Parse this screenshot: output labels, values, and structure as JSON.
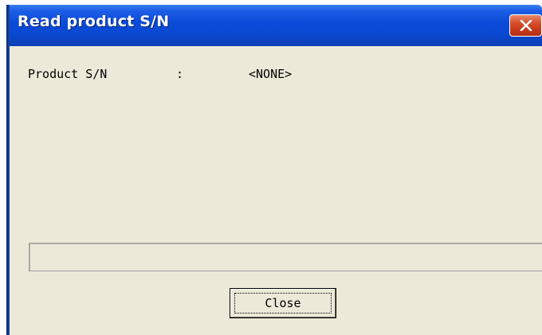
{
  "window": {
    "title": "Read product S/N",
    "close_icon": "close-x-icon",
    "colors": {
      "titlebar": "#0a49d2",
      "close_button": "#d9532e",
      "client_area": "#ece9d8"
    }
  },
  "fields": {
    "product_sn_label": "Product S/N",
    "separator": ":",
    "product_sn_value": "<NONE>"
  },
  "progress": {
    "value_percent": 0
  },
  "buttons": {
    "close_label": "Close"
  }
}
